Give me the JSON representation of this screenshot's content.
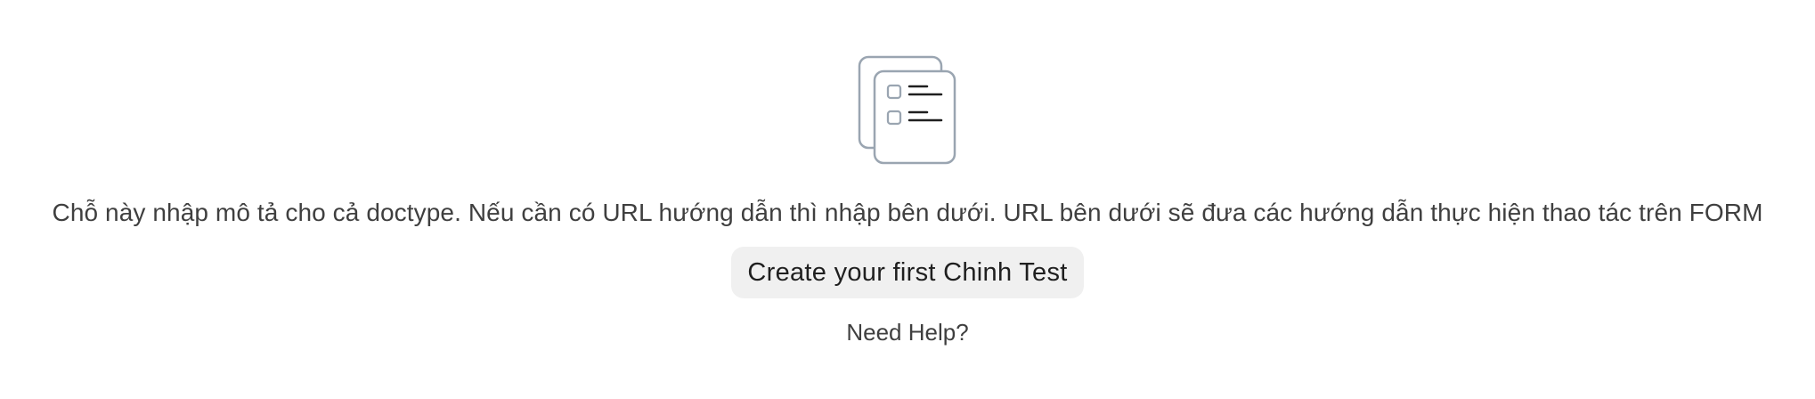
{
  "empty_state": {
    "icon": "document-list-icon",
    "description": "Chỗ này nhập mô tả cho cả doctype. Nếu cần có URL hướng dẫn thì nhập bên dưới. URL bên dưới sẽ đưa các hướng dẫn thực hiện thao tác trên FORM",
    "create_button_label": "Create your first Chinh Test",
    "help_link_label": "Need Help?"
  },
  "colors": {
    "icon_stroke": "#9aa5b1",
    "icon_lines": "#1f1f1f",
    "button_background": "#f0f0f0",
    "text": "#3f3f3f"
  }
}
